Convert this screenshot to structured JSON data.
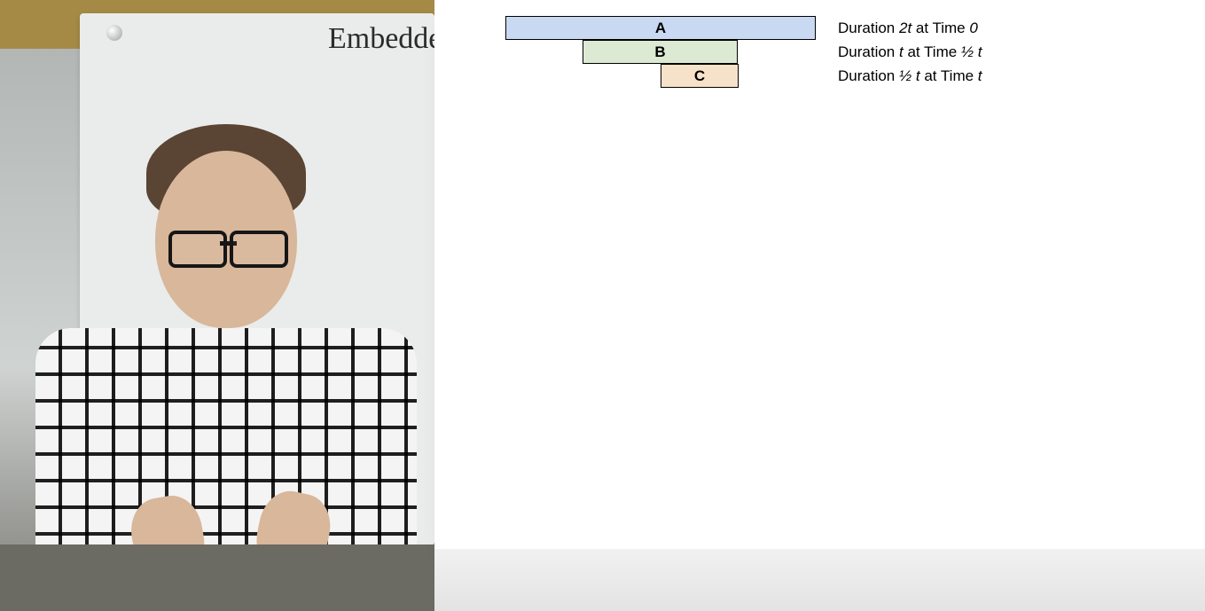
{
  "whiteboard_text": "Embedded",
  "chart_data": {
    "type": "bar",
    "orientation": "horizontal-timeline",
    "unit": "t",
    "bars": [
      {
        "id": "A",
        "label": "A",
        "start": 0,
        "duration": 2,
        "color": "#c9d9f1"
      },
      {
        "id": "B",
        "label": "B",
        "start": 0.5,
        "duration": 1,
        "color": "#dcead4"
      },
      {
        "id": "C",
        "label": "C",
        "start": 1,
        "duration": 0.5,
        "color": "#f6e2c8"
      }
    ],
    "x_range": [
      0,
      2
    ]
  },
  "captions": {
    "A": {
      "prefix": "Duration ",
      "dur": "2t",
      "mid": " at Time ",
      "time": "0"
    },
    "B": {
      "prefix": "Duration ",
      "dur": "t",
      "mid": " at Time ",
      "time": "½ t"
    },
    "C": {
      "prefix": "Duration ",
      "dur": "½ t",
      "mid": " at Time ",
      "time": "t"
    }
  }
}
